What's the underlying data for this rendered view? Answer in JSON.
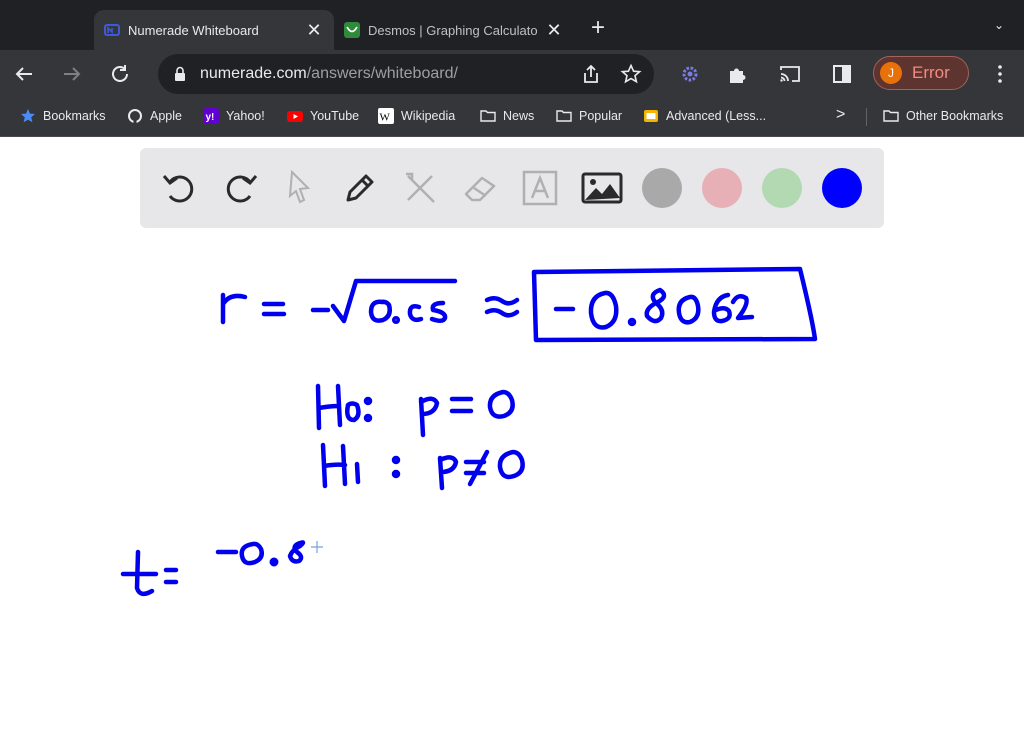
{
  "tabs": [
    {
      "label": "Numerade Whiteboard",
      "close": "✕",
      "icon": "numerade-icon",
      "active": true
    },
    {
      "label": "Desmos | Graphing Calculato",
      "close": "✕",
      "icon": "desmos-icon",
      "active": false
    }
  ],
  "new_tab": "+",
  "tab_menu": "⌄",
  "address": {
    "host": "numerade.com",
    "path": "/answers/whiteboard/"
  },
  "profile": {
    "initial": "J",
    "status": "Error"
  },
  "bookmarks": [
    {
      "label": "Bookmarks",
      "icon": "star-icon"
    },
    {
      "label": "Apple",
      "icon": "apple-icon"
    },
    {
      "label": "Yahoo!",
      "icon": "yahoo-icon"
    },
    {
      "label": "YouTube",
      "icon": "youtube-icon"
    },
    {
      "label": "Wikipedia",
      "icon": "wikipedia-icon"
    },
    {
      "label": "News",
      "icon": "folder-icon"
    },
    {
      "label": "Popular",
      "icon": "folder-icon"
    },
    {
      "label": "Advanced (Less...",
      "icon": "slides-icon"
    }
  ],
  "bookmarks_more": ">",
  "other_bookmarks": "Other Bookmarks",
  "whiteboard": {
    "tools": [
      "undo-icon",
      "redo-icon",
      "pointer-icon",
      "pen-icon",
      "tools-icon",
      "eraser-icon",
      "text-icon",
      "image-icon"
    ],
    "colors": [
      "#a9a9a9",
      "#e6b0b6",
      "#b2d9b2",
      "#0000ff"
    ],
    "selected_color": "#0000ff",
    "ink_color": "#0000ee"
  }
}
